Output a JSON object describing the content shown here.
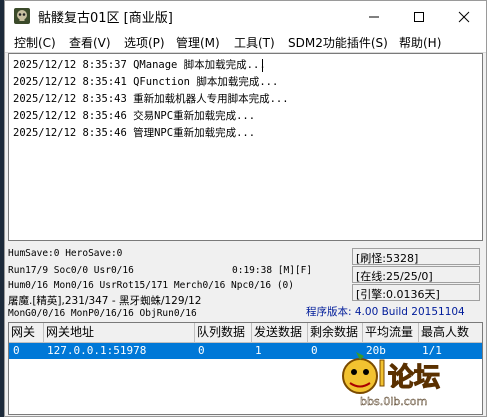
{
  "window": {
    "title": "骷髅复古01区 [商业版]",
    "controls": {
      "minimize": "—",
      "maximize": "☐",
      "close": "✕"
    }
  },
  "menu": [
    {
      "label": "控制(C)"
    },
    {
      "label": "查看(V)"
    },
    {
      "label": "选项(P)"
    },
    {
      "label": "管理(M)"
    },
    {
      "label": "工具(T)"
    },
    {
      "label": "SDM2功能插件(S)"
    },
    {
      "label": "帮助(H)"
    }
  ],
  "log": [
    "2025/12/12 8:35:37 QManage 脚本加载完成...",
    "2025/12/12 8:35:41 QFunction 脚本加载完成...",
    "2025/12/12 8:35:43 重新加载机器人专用脚本完成...",
    "2025/12/12 8:35:46 交易NPC重新加载完成...",
    "2025/12/12 8:35:46 管理NPC重新加载完成..."
  ],
  "status": {
    "humsave": "HumSave:0 HeroSave:0",
    "run": "Run17/9 Soc0/0 Usr0/16",
    "time": "0:19:38 [M][F]",
    "hum": "Hum0/16 Mon0/16 UsrRot15/171 Merch0/16 Npc0/16 (0)",
    "monster": "屠魔.[精英],231/347 - 黑牙蜘蛛/129/12",
    "version": "程序版本: 4.00 Build 20151104",
    "mongo": "MonG0/0/16 MonP0/16/16 ObjRun0/16",
    "refresh": "[刷怪:5328]",
    "online": "[在线:25/25/0]",
    "engine": "[引擎:0.0136天]"
  },
  "table": {
    "headers": [
      "网关",
      "网关地址",
      "队列数据",
      "发送数据",
      "剩余数据",
      "平均流量",
      "最高人数"
    ],
    "rows": [
      [
        "0",
        "127.0.0.1:51978",
        "0",
        "1",
        "0",
        "20b",
        "1/1"
      ]
    ]
  },
  "watermark": {
    "text": "论坛",
    "url": "bbs.0lb.com"
  },
  "colors": {
    "selection": "#0078d7",
    "status_red": "#b00000",
    "status_blue": "#001c9a"
  }
}
